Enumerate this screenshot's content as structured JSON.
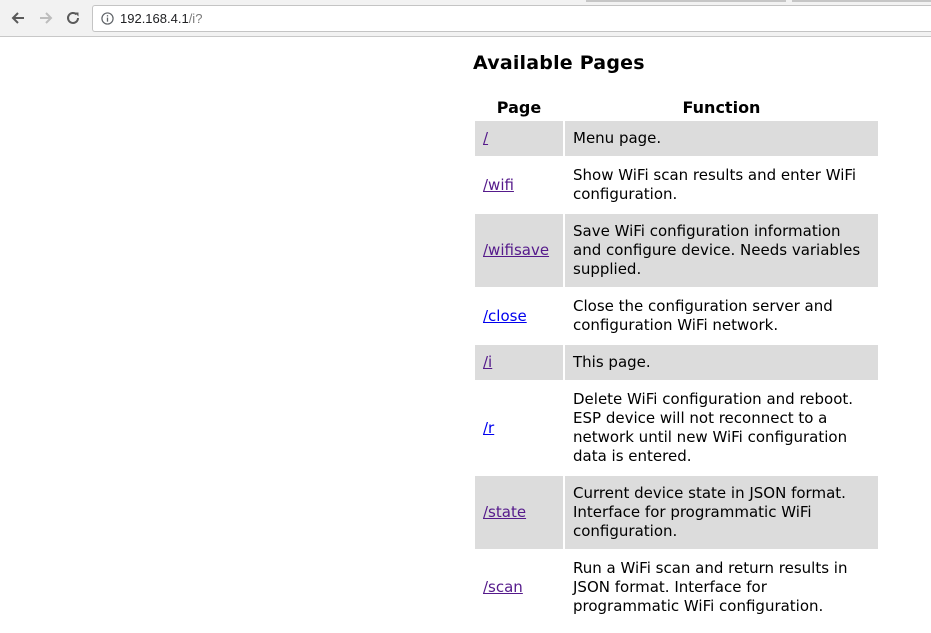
{
  "browser": {
    "url_host": "192.168.4.1",
    "url_path": "/i?"
  },
  "page": {
    "heading": "Available Pages",
    "columns": [
      "Page",
      "Function"
    ],
    "rows": [
      {
        "page": "/",
        "function": "Menu page.",
        "visited": true
      },
      {
        "page": "/wifi",
        "function": "Show WiFi scan results and enter WiFi configuration.",
        "visited": true
      },
      {
        "page": "/wifisave",
        "function": "Save WiFi configuration information and configure device. Needs variables supplied.",
        "visited": true
      },
      {
        "page": "/close",
        "function": "Close the configuration server and configuration WiFi network.",
        "visited": false
      },
      {
        "page": "/i",
        "function": "This page.",
        "visited": true
      },
      {
        "page": "/r",
        "function": "Delete WiFi configuration and reboot. ESP device will not reconnect to a network until new WiFi configuration data is entered.",
        "visited": false
      },
      {
        "page": "/state",
        "function": "Current device state in JSON format. Interface for programmatic WiFi configuration.",
        "visited": true
      },
      {
        "page": "/scan",
        "function": "Run a WiFi scan and return results in JSON format. Interface for programmatic WiFi configuration.",
        "visited": true
      }
    ]
  }
}
